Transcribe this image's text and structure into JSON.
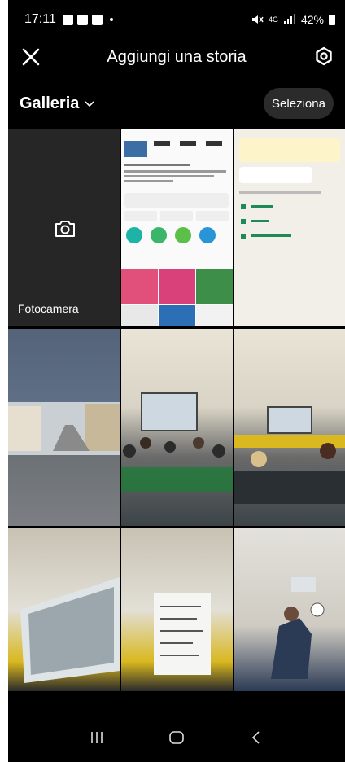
{
  "status_bar": {
    "time": "17:11",
    "signal": "4G",
    "battery": "42%"
  },
  "header": {
    "title": "Aggiungi una storia"
  },
  "gallery_row": {
    "album": "Galleria",
    "select_label": "Seleziona"
  },
  "grid": {
    "camera_label": "Fotocamera"
  },
  "colors": {
    "background": "#000000",
    "camera_tile": "#262626",
    "select_button": "#2b2b2b"
  }
}
